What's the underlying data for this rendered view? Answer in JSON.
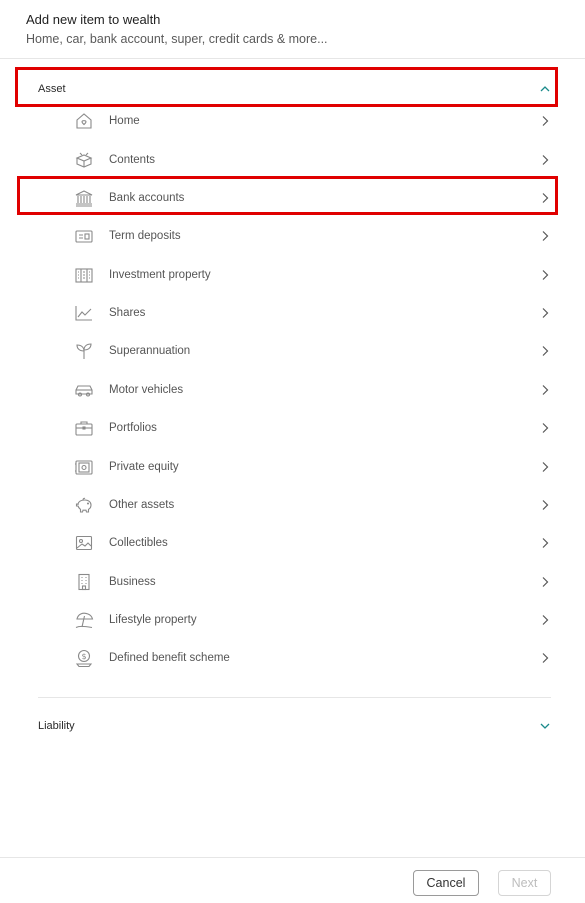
{
  "dialog": {
    "title": "Add new item to wealth",
    "subtitle": "Home, car, bank account, super, credit cards & more..."
  },
  "asset": {
    "label": "Asset",
    "expanded": true,
    "chevron_icon": "chevron-up-icon"
  },
  "items": [
    {
      "label": "Home",
      "icon": "home-icon"
    },
    {
      "label": "Contents",
      "icon": "contents-icon"
    },
    {
      "label": "Bank accounts",
      "icon": "bank-icon"
    },
    {
      "label": "Term deposits",
      "icon": "term-deposit-icon"
    },
    {
      "label": "Investment property",
      "icon": "investment-property-icon"
    },
    {
      "label": "Shares",
      "icon": "shares-chart-icon"
    },
    {
      "label": "Superannuation",
      "icon": "sprout-icon"
    },
    {
      "label": "Motor vehicles",
      "icon": "car-icon"
    },
    {
      "label": "Portfolios",
      "icon": "briefcase-icon"
    },
    {
      "label": "Private equity",
      "icon": "safe-icon"
    },
    {
      "label": "Other assets",
      "icon": "piggy-bank-icon"
    },
    {
      "label": "Collectibles",
      "icon": "picture-icon"
    },
    {
      "label": "Business",
      "icon": "building-icon"
    },
    {
      "label": "Lifestyle property",
      "icon": "beach-umbrella-icon"
    },
    {
      "label": "Defined benefit scheme",
      "icon": "coin-hand-icon"
    }
  ],
  "liability": {
    "label": "Liability",
    "expanded": false,
    "chevron_icon": "chevron-down-icon"
  },
  "footer": {
    "cancel_label": "Cancel",
    "next_label": "Next",
    "next_enabled": false
  },
  "colors": {
    "accent_teal": "#1a8a8a",
    "highlight_red": "#e00000",
    "icon_gray": "#8a8a8a"
  }
}
